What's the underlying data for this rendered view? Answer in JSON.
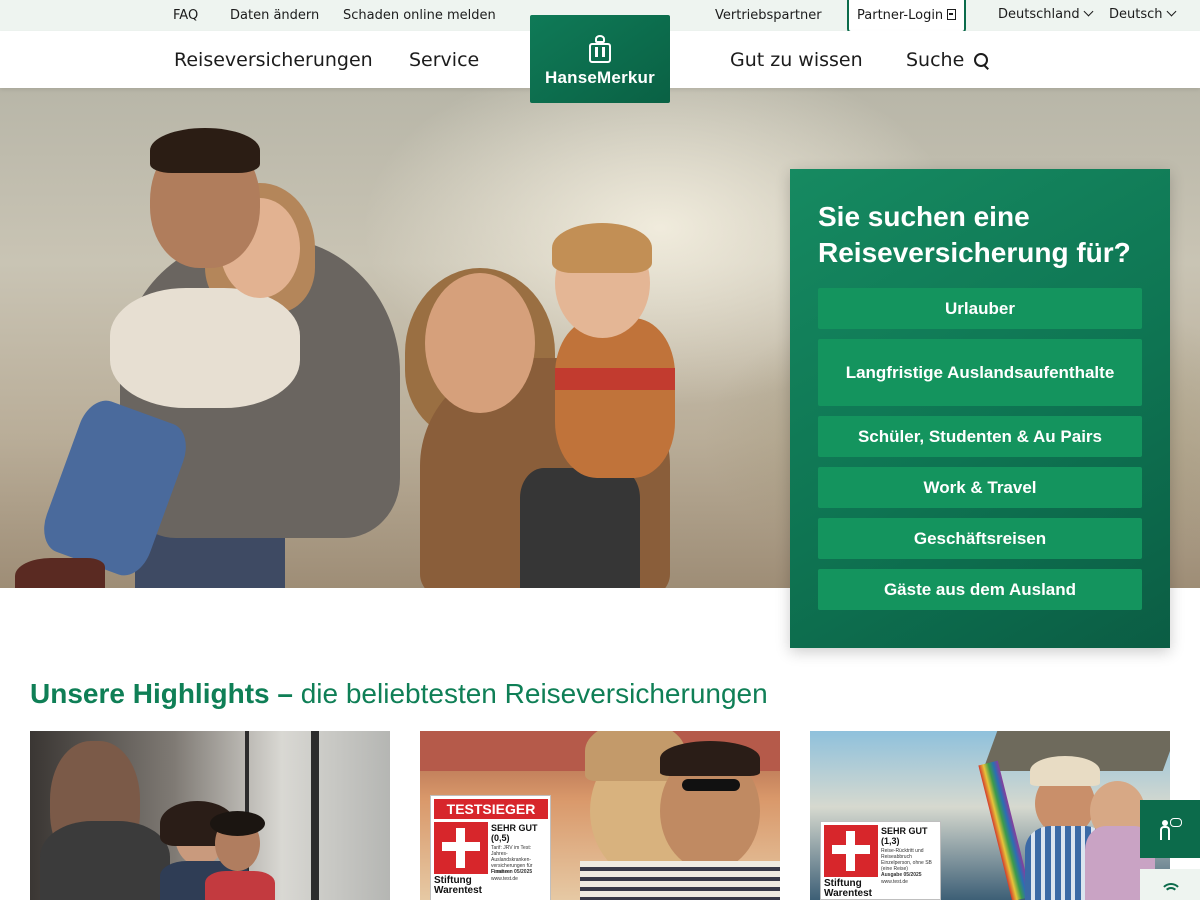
{
  "utility_nav": {
    "faq": "FAQ",
    "daten_aendern": "Daten ändern",
    "schaden_melden": "Schaden online melden",
    "vertriebspartner": "Vertriebspartner",
    "partner_login": "Partner-Login",
    "country": "Deutschland",
    "language": "Deutsch"
  },
  "main_nav": {
    "items": [
      "Reiseversicherungen",
      "Service",
      "Gut zu wissen",
      "Suche"
    ]
  },
  "logo": {
    "text": "HanseMerkur"
  },
  "selector": {
    "title": "Sie suchen eine Reiseversicherung für?",
    "options": [
      "Urlauber",
      "Langfristige Auslandsaufenthalte",
      "Schüler, Studenten & Au Pairs",
      "Work & Travel",
      "Geschäftsreisen",
      "Gäste aus dem Ausland"
    ]
  },
  "highlights": {
    "title_strong": "Unsere Highlights –",
    "title_rest": " die beliebtesten Reiseversicherungen"
  },
  "badges": [
    {
      "top": "TESTSIEGER",
      "rating": "SEHR GUT",
      "score": "(0,5)",
      "detail": "Tarif: JRV im Test: Jahres-Auslandskranken-versicherungen für Familien",
      "issue": "Finanzen 05/2025",
      "url": "www.test.de",
      "org_line1": "Stiftung",
      "org_line2": "Warentest"
    },
    {
      "rating": "SEHR GUT",
      "score": "(1,3)",
      "detail": "Reise-Rücktritt und Reiseabbruch Einzelperson, ohne SB (eine Reise)",
      "issue": "Ausgabe 05/2025",
      "url": "www.test.de",
      "org_line1": "Stiftung",
      "org_line2": "Warentest"
    }
  ],
  "colors": {
    "brand_green": "#0f7a57",
    "button_green": "#14945e",
    "utility_bg": "#eef4f0",
    "badge_red": "#d7262b"
  },
  "icons": [
    "search-icon",
    "login-icon",
    "chevron-down-icon",
    "chat-icon",
    "call-icon"
  ]
}
